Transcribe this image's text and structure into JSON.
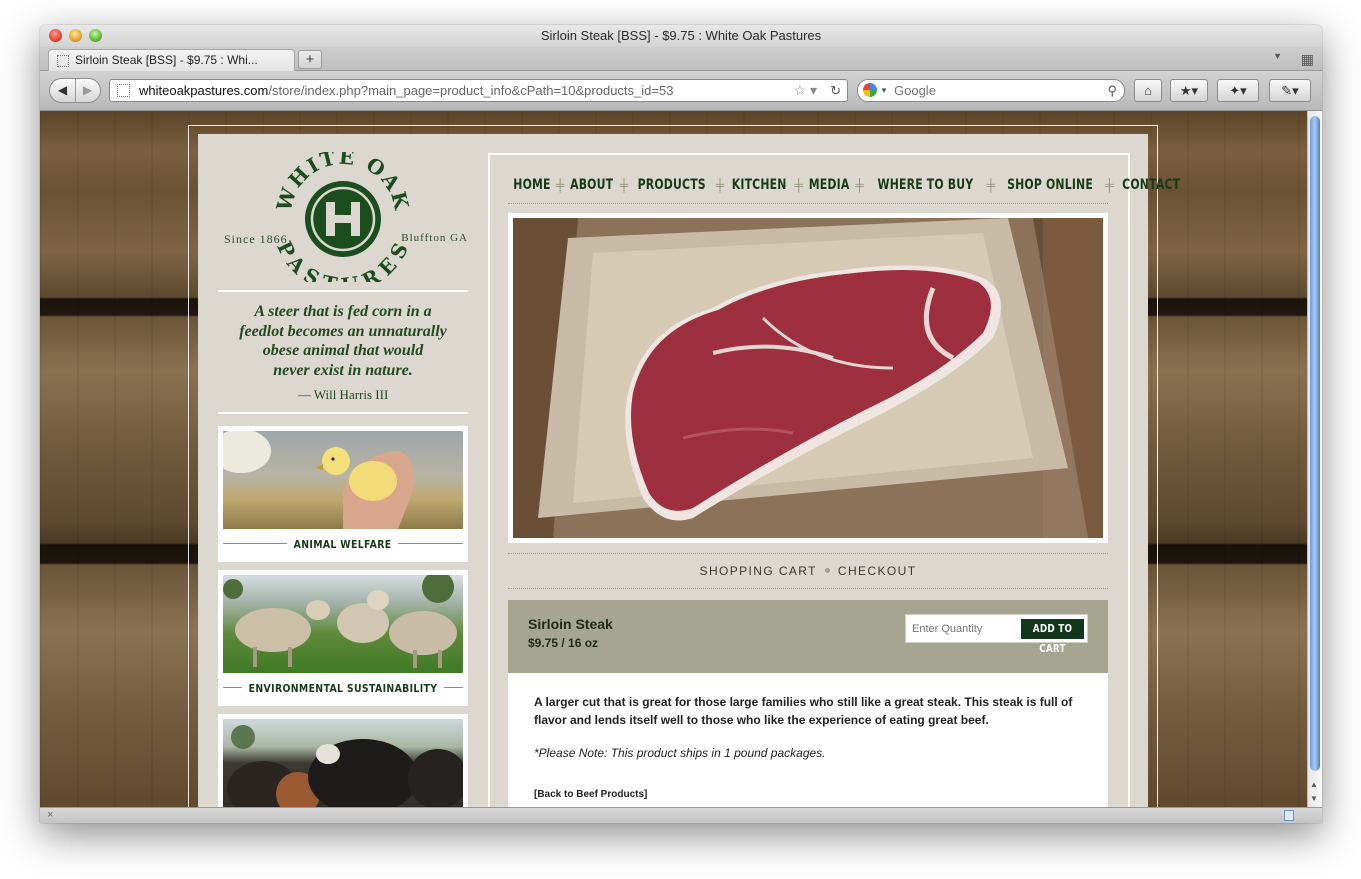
{
  "browser": {
    "window_title": "Sirloin Steak [BSS] - $9.75 : White Oak Pastures",
    "tab_title": "Sirloin Steak [BSS] - $9.75 : Whi...",
    "url_domain": "whiteoakpastures.com",
    "url_path": "/store/index.php?main_page=product_info&cPath=10&products_id=53",
    "search_placeholder": "Google"
  },
  "site": {
    "logo": {
      "top_text": "WHITE OAK",
      "bottom_text": "PASTURES",
      "monogram": "H",
      "since": "Since 1866",
      "location": "Bluffton GA"
    },
    "quote": {
      "lines": [
        "A steer that is fed corn in a",
        "feedlot becomes an unnaturally",
        "obese animal that would",
        "never exist in nature."
      ],
      "author": "— Will Harris III"
    },
    "promos": [
      {
        "caption": "ANIMAL WELFARE"
      },
      {
        "caption": "ENVIRONMENTAL SUSTAINABILITY"
      },
      {
        "caption": ""
      }
    ],
    "nav": [
      "HOME",
      "ABOUT",
      "PRODUCTS",
      "KITCHEN",
      "MEDIA",
      "WHERE TO BUY",
      "SHOP ONLINE",
      "CONTACT"
    ],
    "cart_links": {
      "shopping_cart": "SHOPPING CART",
      "checkout": "CHECKOUT"
    },
    "product": {
      "name": "Sirloin Steak",
      "price": "$9.75 / 16 oz",
      "qty_placeholder": "Enter Quantity",
      "add_button": "ADD TO CART",
      "description": "A larger cut that is great for those large families who still like a great steak. This steak is full of flavor and lends itself well to those who like the experience of eating great beef.",
      "note": "*Please Note: This product ships in 1 pound packages.",
      "back_link": "[Back to Beef Products]"
    }
  },
  "colors": {
    "brand_green": "#1b4d1f",
    "panel": "#ddd8cf",
    "product_header": "#a5a592"
  }
}
